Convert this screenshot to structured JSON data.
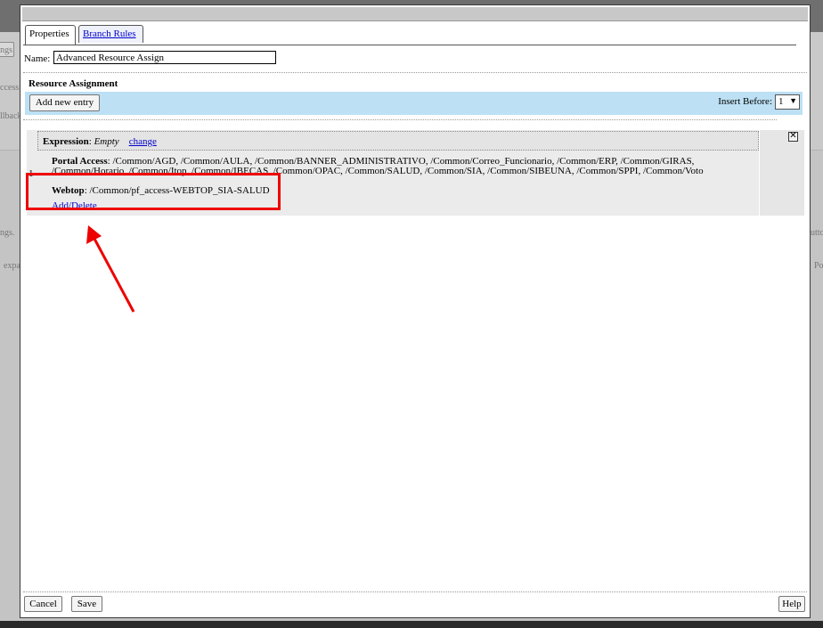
{
  "background": {
    "fragments": [
      "ngs",
      "ccess",
      "llback",
      "ngs.",
      "expa",
      "utto",
      "Po"
    ]
  },
  "tabs": [
    {
      "label": "Properties"
    },
    {
      "label": "Branch Rules"
    }
  ],
  "name": {
    "label": "Name:",
    "value": "Advanced Resource Assign"
  },
  "resource": {
    "title": "Resource Assignment",
    "add_button": "Add new entry",
    "insert_label": "Insert Before:",
    "insert_value": "1"
  },
  "entry": {
    "number": "1",
    "expression_label": "Expression",
    "expression_value": "Empty",
    "change_link": "change",
    "portal_label": "Portal Access",
    "portal_value": "/Common/AGD, /Common/AULA, /Common/BANNER_ADMINISTRATIVO, /Common/Correo_Funcionario, /Common/ERP, /Common/GIRAS, /Common/Horario, /Common/Itop, /Common/IBECAS, /Common/OPAC, /Common/SALUD, /Common/SIA, /Common/SIBEUNA, /Common/SPPI, /Common/Voto",
    "webtop_label": "Webtop",
    "webtop_value": "/Common/pf_access-WEBTOP_SIA-SALUD",
    "add_delete_link": "Add/Delete",
    "close_glyph": "✕"
  },
  "footer": {
    "cancel": "Cancel",
    "save": "Save",
    "help": "Help"
  },
  "colors": {
    "highlight": "#e00000",
    "toolbar": "#bde0f4"
  }
}
